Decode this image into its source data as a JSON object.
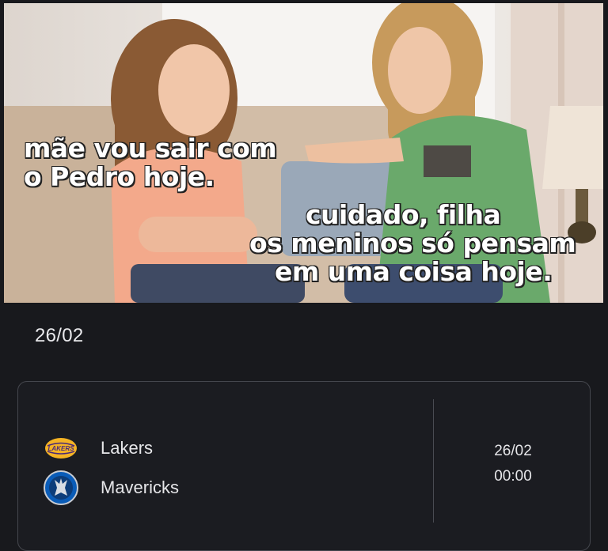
{
  "meme": {
    "caption_left": [
      "mãe vou sair com",
      "o Pedro hoje."
    ],
    "caption_right": [
      "cuidado, filha",
      "os meninos só pensam",
      "em uma coisa hoje."
    ]
  },
  "schedule": {
    "date_header": "26/02",
    "match": {
      "home_team": {
        "name": "Lakers",
        "logo_icon": "lakers-logo-icon",
        "logo_text": "LAKERS"
      },
      "away_team": {
        "name": "Mavericks",
        "logo_icon": "mavericks-logo-icon"
      },
      "date": "26/02",
      "time": "00:00"
    }
  },
  "colors": {
    "background": "#18191d",
    "card_border": "#45474e",
    "text": "#e6e6e9",
    "lakers_gold": "#f5b324",
    "lakers_purple": "#4a2a7a",
    "mavericks_blue": "#0a5cb8"
  }
}
